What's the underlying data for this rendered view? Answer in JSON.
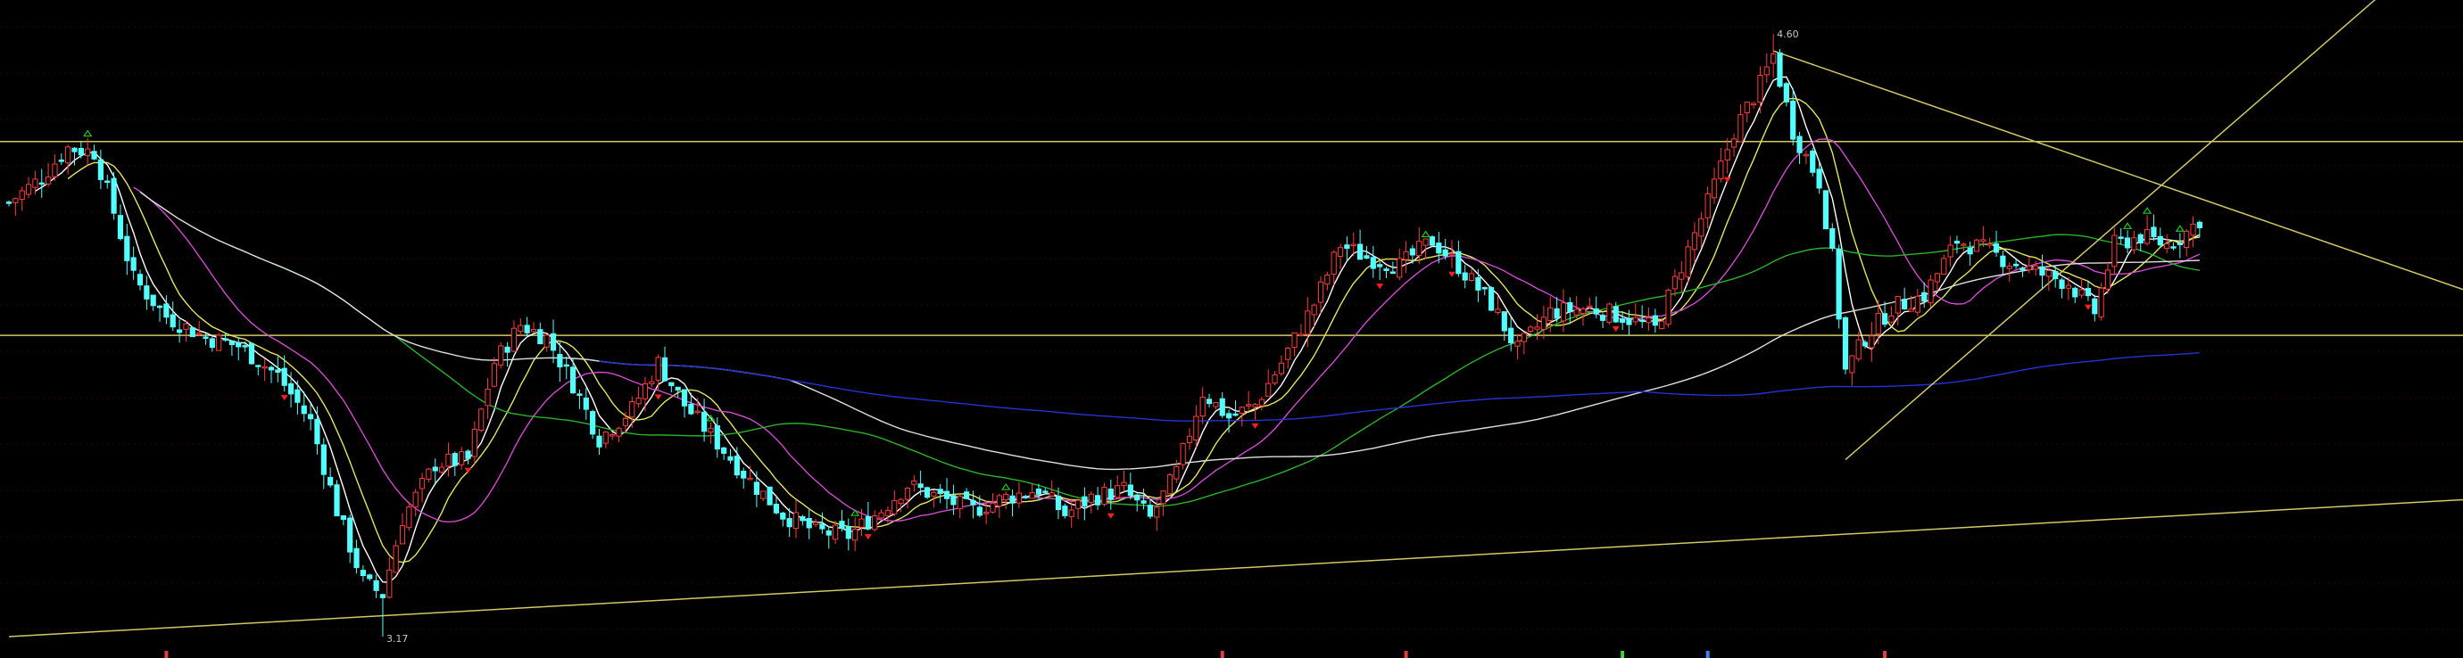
{
  "chart_data": {
    "type": "candlestick",
    "title": "",
    "xlabel": "",
    "ylabel": "",
    "ylim": [
      3.0,
      4.55
    ],
    "grid": true,
    "background": "#000000",
    "colors": {
      "up": "#ff3c3c",
      "down": "#54ffff",
      "ma5": "#ffffff",
      "ma10": "#e6e65a",
      "ma20": "#d24bd2",
      "ma60": "#28b428",
      "ma120": "#e0e0e0",
      "ma250": "#2333d6",
      "trendline": "#d2c864",
      "hline": "#d2c864",
      "grid": "#3a0000",
      "signal_up": "#ff2020",
      "signal_down": "#20c820",
      "label": "#c8c8c8"
    },
    "annotations": {
      "high_label": "4.60",
      "low_label": "3.17"
    },
    "horizontal_levels": [
      4.345,
      3.885
    ],
    "trend_lines": [
      {
        "name": "support-1",
        "from": [
          0,
          3.17
        ],
        "to": [
          334,
          3.46
        ]
      },
      {
        "name": "support-2",
        "from": [
          280,
          3.59
        ],
        "to": [
          334,
          4.32
        ]
      },
      {
        "name": "resistance",
        "from": [
          269,
          4.56
        ],
        "to": [
          334,
          4.21
        ]
      }
    ],
    "anchor_points": [
      [
        0,
        4.2
      ],
      [
        5,
        4.26
      ],
      [
        9,
        4.33
      ],
      [
        13,
        4.32
      ],
      [
        15,
        4.23
      ],
      [
        19,
        4.02
      ],
      [
        24,
        3.93
      ],
      [
        30,
        3.88
      ],
      [
        35,
        3.86
      ],
      [
        41,
        3.79
      ],
      [
        46,
        3.68
      ],
      [
        50,
        3.47
      ],
      [
        54,
        3.3
      ],
      [
        57,
        3.27
      ],
      [
        60,
        3.45
      ],
      [
        65,
        3.58
      ],
      [
        70,
        3.59
      ],
      [
        74,
        3.82
      ],
      [
        78,
        3.91
      ],
      [
        82,
        3.88
      ],
      [
        86,
        3.77
      ],
      [
        90,
        3.64
      ],
      [
        95,
        3.71
      ],
      [
        99,
        3.82
      ],
      [
        103,
        3.72
      ],
      [
        108,
        3.63
      ],
      [
        113,
        3.54
      ],
      [
        118,
        3.46
      ],
      [
        123,
        3.42
      ],
      [
        128,
        3.41
      ],
      [
        133,
        3.47
      ],
      [
        137,
        3.53
      ],
      [
        142,
        3.5
      ],
      [
        147,
        3.47
      ],
      [
        152,
        3.5
      ],
      [
        157,
        3.52
      ],
      [
        161,
        3.46
      ],
      [
        165,
        3.5
      ],
      [
        170,
        3.52
      ],
      [
        174,
        3.45
      ],
      [
        178,
        3.56
      ],
      [
        182,
        3.75
      ],
      [
        186,
        3.69
      ],
      [
        190,
        3.72
      ],
      [
        194,
        3.82
      ],
      [
        199,
        3.96
      ],
      [
        203,
        4.1
      ],
      [
        207,
        4.07
      ],
      [
        212,
        4.05
      ],
      [
        217,
        4.11
      ],
      [
        221,
        4.05
      ],
      [
        226,
        3.96
      ],
      [
        230,
        3.85
      ],
      [
        235,
        3.94
      ],
      [
        241,
        3.95
      ],
      [
        246,
        3.93
      ],
      [
        251,
        3.9
      ],
      [
        255,
        4.05
      ],
      [
        259,
        4.2
      ],
      [
        263,
        4.37
      ],
      [
        267,
        4.48
      ],
      [
        269,
        4.55
      ],
      [
        272,
        4.37
      ],
      [
        276,
        4.25
      ],
      [
        278,
        4.07
      ],
      [
        280,
        3.8
      ],
      [
        283,
        3.88
      ],
      [
        287,
        3.95
      ],
      [
        292,
        3.98
      ],
      [
        297,
        4.11
      ],
      [
        301,
        4.09
      ],
      [
        305,
        4.06
      ],
      [
        310,
        4.03
      ],
      [
        314,
        4.01
      ],
      [
        318,
        3.94
      ],
      [
        321,
        4.1
      ],
      [
        325,
        4.12
      ],
      [
        329,
        4.1
      ],
      [
        332,
        4.13
      ],
      [
        334,
        4.16
      ]
    ],
    "moving_averages": [
      {
        "name": "ma5",
        "period": 5
      },
      {
        "name": "ma10",
        "period": 10
      },
      {
        "name": "ma20",
        "period": 20
      },
      {
        "name": "ma60",
        "period": 60
      },
      {
        "name": "ma120",
        "period": 120
      },
      {
        "name": "ma250",
        "period": 250
      }
    ],
    "bottom_markers": [
      24,
      185,
      213,
      246,
      259,
      286
    ]
  }
}
